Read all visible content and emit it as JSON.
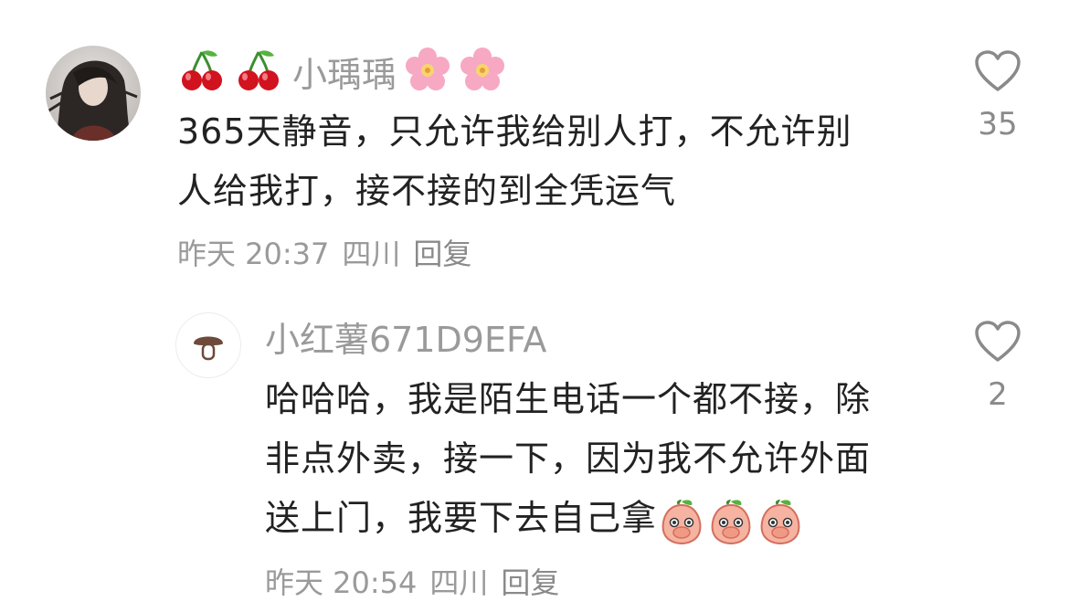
{
  "comment": {
    "username": "小瑀瑀",
    "username_prefix_emoji": "cherry-icon",
    "username_suffix_emoji": "flower-icon",
    "text_lines": [
      "365天静音，只允许我给别人打，不允许别",
      "人给我打，接不接的到全凭运气"
    ],
    "time": "昨天 20:37",
    "location": "四川",
    "reply_label": "回复",
    "like_count": "35"
  },
  "reply": {
    "username": "小红薯671D9EFA",
    "avatar_icon": "mushroom-icon",
    "text_lines": [
      "哈哈哈，我是陌生电话一个都不接，除",
      "非点外卖，接一下，因为我不允许外面",
      "送上门，我要下去自己拿"
    ],
    "trailing_emoji": "peach-covering-mouth-icon",
    "time": "昨天 20:54",
    "location": "四川",
    "reply_label": "回复",
    "like_count": "2"
  },
  "colors": {
    "text": "#222222",
    "secondary": "#9a9a9a",
    "icon": "#8a8a8a"
  }
}
